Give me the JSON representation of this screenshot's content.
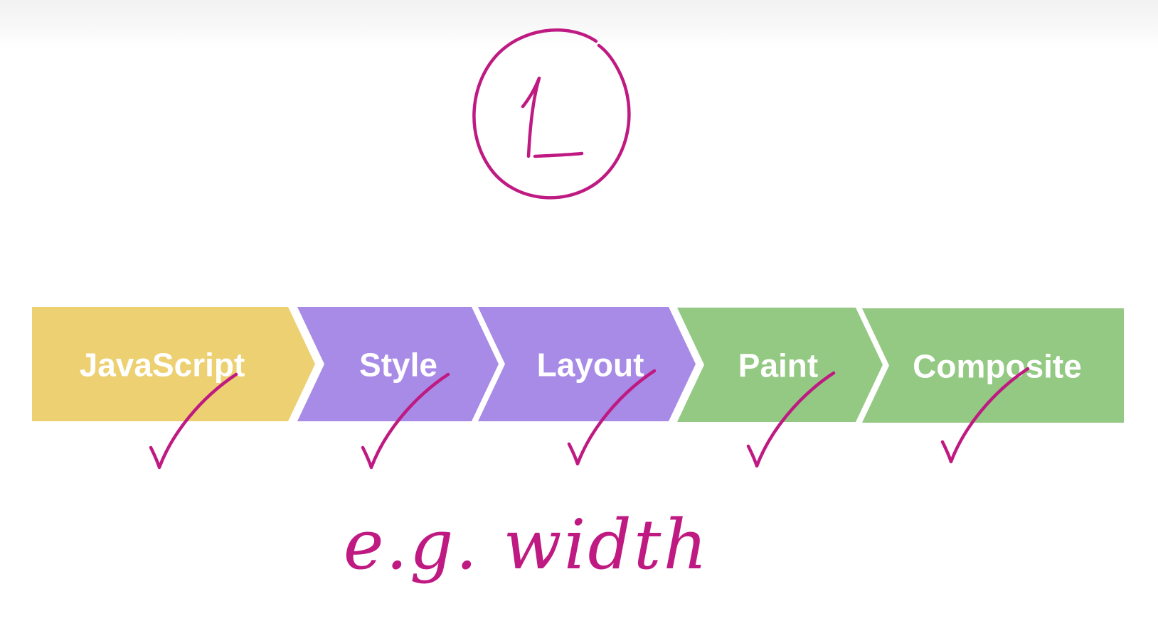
{
  "step_number": "1",
  "pipeline": {
    "stages": [
      {
        "label": "JavaScript",
        "color": "#ecd071",
        "checked": true
      },
      {
        "label": "Style",
        "color": "#a78be6",
        "checked": true
      },
      {
        "label": "Layout",
        "color": "#a78be6",
        "checked": true
      },
      {
        "label": "Paint",
        "color": "#93c982",
        "checked": true
      },
      {
        "label": "Composite",
        "color": "#93c982",
        "checked": true
      }
    ]
  },
  "example_note": "e.g. width",
  "colors": {
    "ink": "#bf1a82",
    "javascript": "#ecd071",
    "style_layout": "#a78be6",
    "paint_composite": "#93c982"
  }
}
